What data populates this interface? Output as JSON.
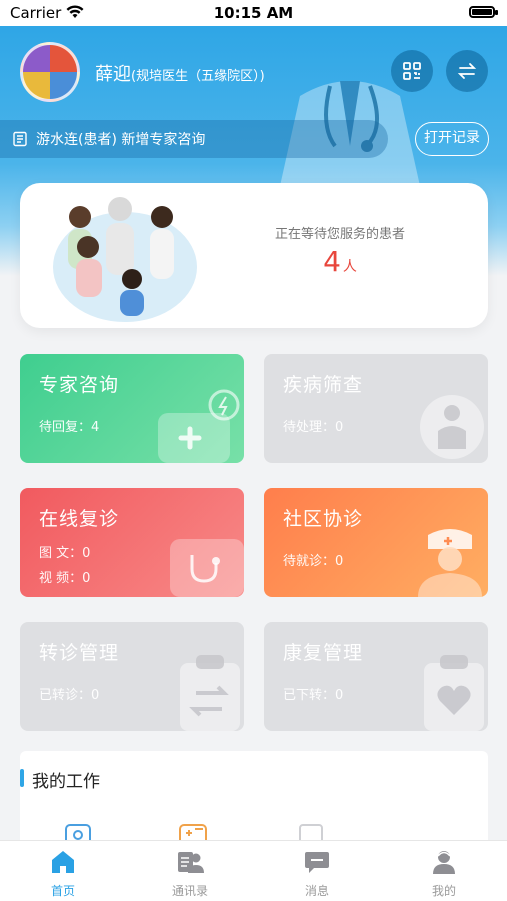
{
  "status_bar": {
    "carrier": "Carrier",
    "time": "10:15 AM"
  },
  "header": {
    "doctor_name": "薛迎",
    "doctor_title": "(规培医生（五缘院区）)",
    "notice": "游水连(患者) 新增专家咨询",
    "open_button": "打开记录"
  },
  "waiting": {
    "label": "正在等待您服务的患者",
    "count": "4",
    "unit": "人"
  },
  "tiles": [
    {
      "title": "专家咨询",
      "lines": [
        "待回复：4"
      ],
      "color": "#3fce8f"
    },
    {
      "title": "疾病筛查",
      "lines": [
        "待处理：0"
      ],
      "color": "#dedfe2"
    },
    {
      "title": "在线复诊",
      "lines": [
        "图 文：0",
        "视 频：0"
      ],
      "color": "#f15a5f"
    },
    {
      "title": "社区协诊",
      "lines": [
        "待就诊：0"
      ],
      "color": "#ff7e4c"
    },
    {
      "title": "转诊管理",
      "lines": [
        "已转诊：0"
      ],
      "color": "#dedfe2"
    },
    {
      "title": "康复管理",
      "lines": [
        "已下转：0"
      ],
      "color": "#dedfe2"
    }
  ],
  "my_work": {
    "title": "我的工作"
  },
  "tabbar": [
    {
      "label": "首页",
      "icon": "home-icon",
      "active": true
    },
    {
      "label": "通讯录",
      "icon": "contacts-icon"
    },
    {
      "label": "消息",
      "icon": "message-icon"
    },
    {
      "label": "我的",
      "icon": "profile-icon"
    }
  ],
  "accent_color": "#2aa1e4"
}
